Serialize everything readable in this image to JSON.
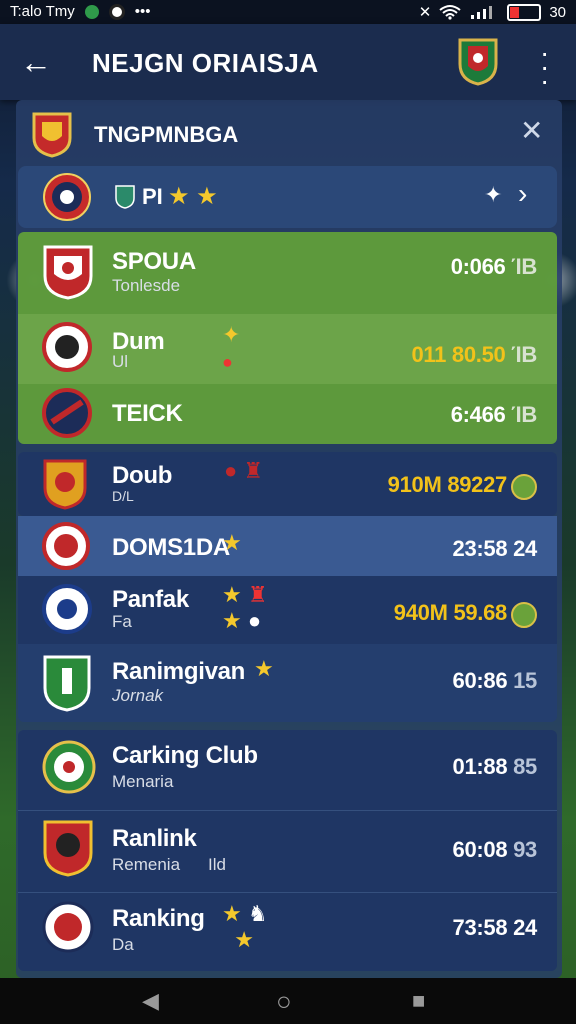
{
  "status_bar": {
    "time_text": "T:alo Tmy",
    "battery_text": "30"
  },
  "app_bar": {
    "title": "NEJGN ORIAISJA"
  },
  "panel": {
    "title": "TNGPMNBGA",
    "filter": {
      "label": "PI"
    }
  },
  "rows": [
    {
      "name": "SPOUA",
      "sub": "Tonlesde",
      "value": "0:066",
      "suffix": "ΊΒ"
    },
    {
      "name": "Dum",
      "sub": "Ul",
      "value": "011 80.50",
      "suffix": "ΊΒ"
    },
    {
      "name": "TEICK",
      "sub": "",
      "value": "6:466",
      "suffix": "ΊΒ"
    },
    {
      "name": "Doub",
      "sub": "D/L",
      "value": "910M 89227",
      "suffix": ""
    },
    {
      "name": "DOMS1DA",
      "sub": "",
      "value": "23:58",
      "suffix": "24"
    },
    {
      "name": "Panfak",
      "sub": "Fa",
      "value": "940M 59.68",
      "suffix": ""
    },
    {
      "name": "Ranimgivan",
      "sub": "Jornak",
      "value": "60:86",
      "suffix": "15"
    },
    {
      "name": "Carking Club",
      "sub": "Menaria",
      "value": "01:88",
      "suffix": "85"
    },
    {
      "name": "Ranlink",
      "sub": "Remenia",
      "sub2": "Ild",
      "value": "60:08",
      "suffix": "93"
    },
    {
      "name": "Ranking",
      "sub": "Da",
      "value": "73:58",
      "suffix": "24"
    }
  ],
  "colors": {
    "accent_gold": "#f2c21a",
    "star": "#f4c82c",
    "highlight_green": "#609e3a"
  }
}
